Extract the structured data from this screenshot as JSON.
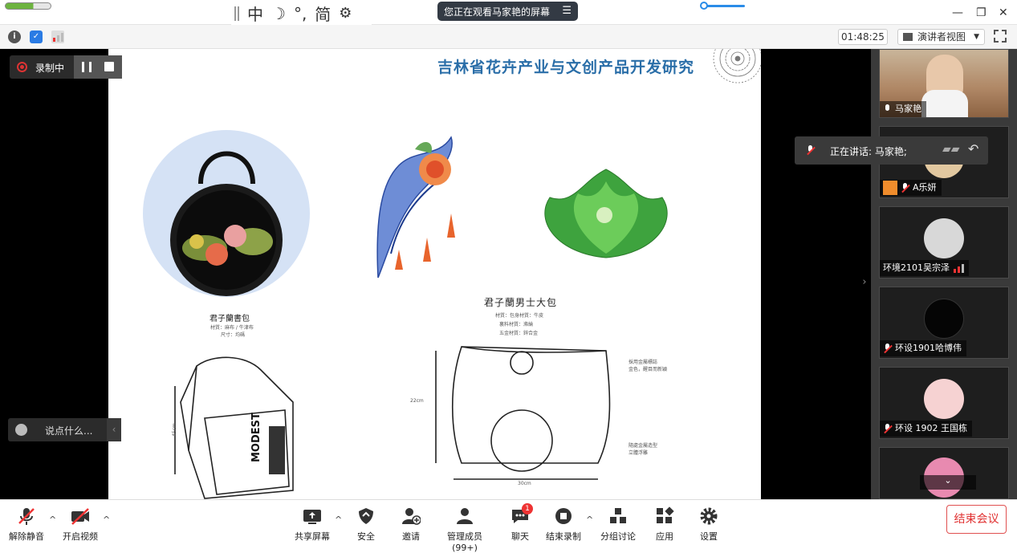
{
  "ime": {
    "lang": "中",
    "moon": "☽",
    "punct": "°,",
    "simplified": "简"
  },
  "banner": {
    "text": "您正在观看马家艳的屏幕"
  },
  "toolbar": {
    "timer": "01:48:25",
    "presenter_view": "演讲者视图"
  },
  "recording": {
    "label": "录制中"
  },
  "chat": {
    "placeholder": "说点什么..."
  },
  "slide": {
    "title": "吉林省花卉产业与文创产品开发研究",
    "caption_left": "君子蘭書包",
    "caption_left_meta1": "材質：麻布 / 牛津布",
    "caption_left_meta2": "尺寸：均碼",
    "caption_right": "君子蘭男士大包",
    "caption_right_meta1": "材質：包身材質：牛皮",
    "caption_right_meta2": "裏料材質：滌綸",
    "caption_right_meta3": "五金材質：鋅合金",
    "bag_note": "採用金屬標誌\n金色，醒目而新穎",
    "bag_note2": "隨處金屬造型\n立體浮雕",
    "dim_height": "22cm",
    "dim_width": "30cm",
    "dim_left": "45cm",
    "backpack_text": "MODEST"
  },
  "speaking": {
    "label": "正在讲话: 马家艳;"
  },
  "participants": [
    {
      "name": "马家艳"
    },
    {
      "name": "A乐妍"
    },
    {
      "name": "环境2101吴宗泽"
    },
    {
      "name": "环设1901哈博伟"
    },
    {
      "name": "环设 1902 王国栋"
    },
    {
      "name": ""
    }
  ],
  "bottom": {
    "unmute": "解除静音",
    "video": "开启视频",
    "share": "共享屏幕",
    "security": "安全",
    "invite": "邀请",
    "members": "管理成员(99+)",
    "chat": "聊天",
    "chat_badge": "1",
    "end_rec": "结束录制",
    "breakout": "分组讨论",
    "apps": "应用",
    "settings": "设置",
    "end_meeting": "结束会议"
  }
}
